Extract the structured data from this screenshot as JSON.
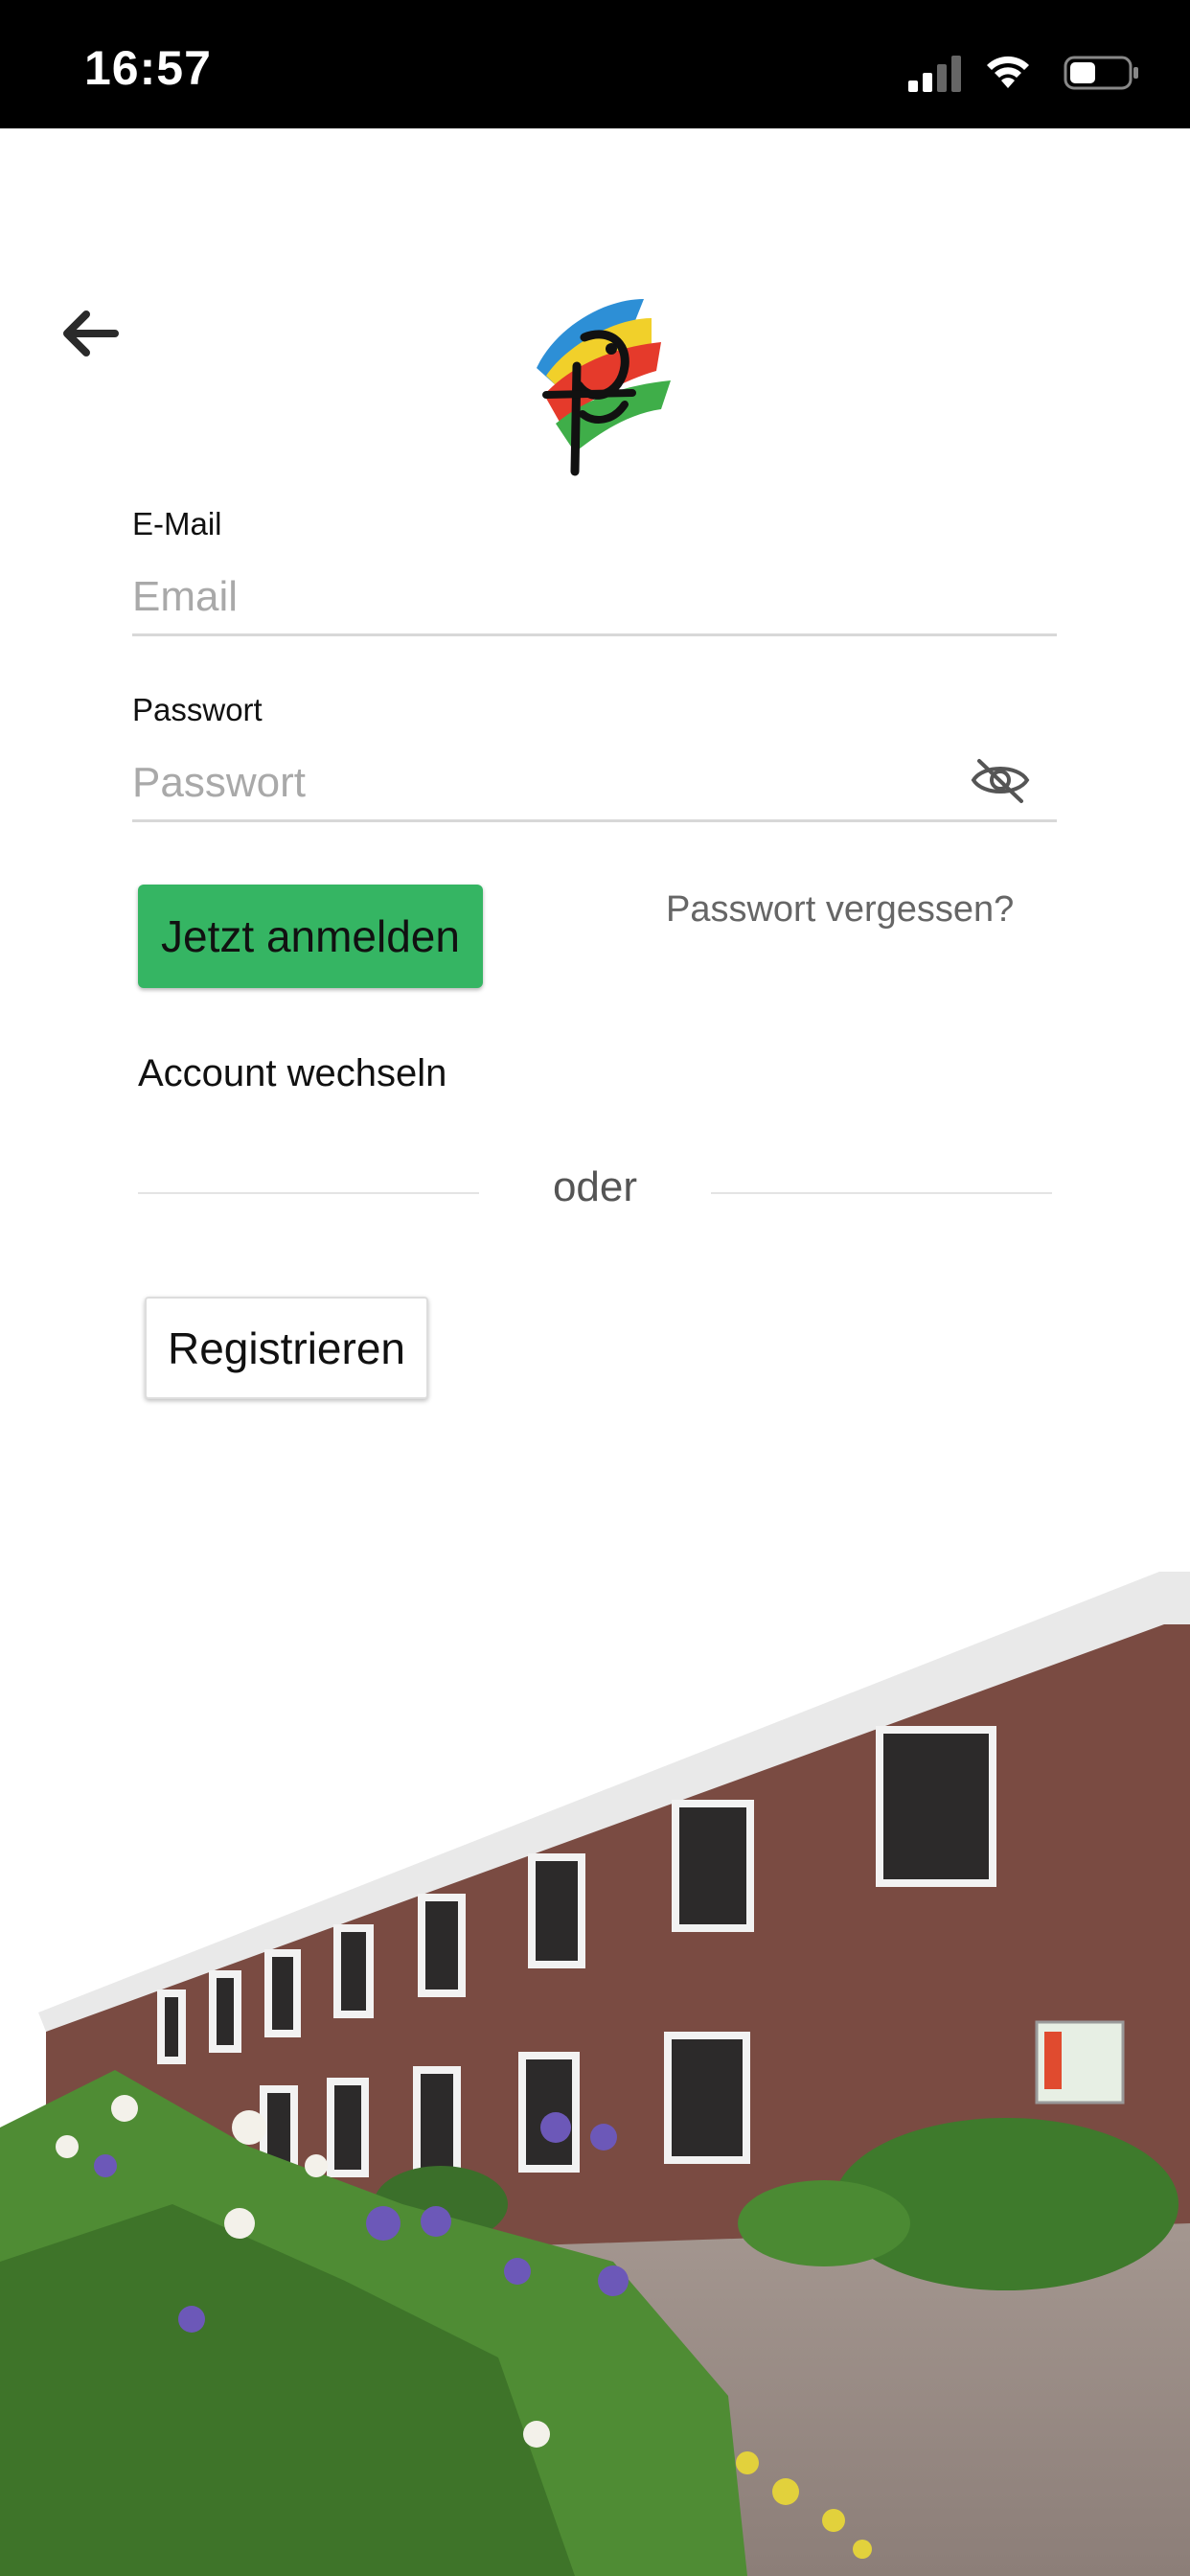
{
  "status_bar": {
    "time": "16:57"
  },
  "header": {
    "back_icon": "arrow-left-icon",
    "logo": "church-bird-logo"
  },
  "form": {
    "email": {
      "label": "E-Mail",
      "placeholder": "Email",
      "value": ""
    },
    "password": {
      "label": "Passwort",
      "placeholder": "Passwort",
      "value": "",
      "toggle_icon": "eye-off-icon"
    },
    "login_button": "Jetzt anmelden",
    "forgot_password": "Passwort vergessen?",
    "switch_account": "Account wechseln",
    "divider": "oder",
    "register_button": "Registrieren"
  },
  "colors": {
    "accent_green": "#35b563",
    "status_bar": "#000000"
  }
}
